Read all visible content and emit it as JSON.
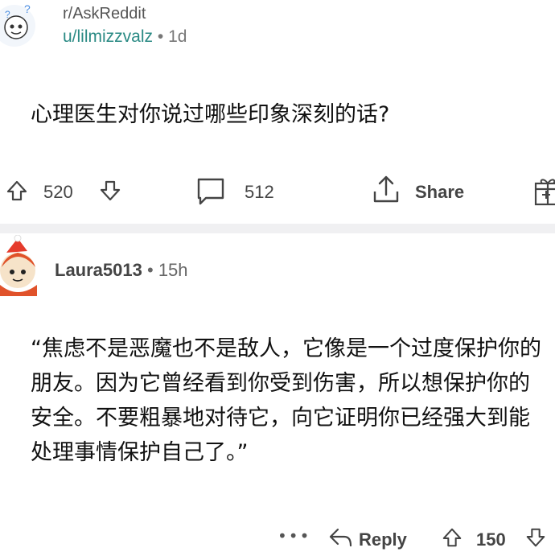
{
  "post": {
    "subreddit": "r/AskReddit",
    "username": "u/lilmizzvalz",
    "separator": "•",
    "age": "1d",
    "title": "心理医生对你说过哪些印象深刻的话?",
    "upvotes": "520",
    "comments": "512",
    "share_label": "Share"
  },
  "comment": {
    "username": "Laura5013",
    "separator": "•",
    "age": "15h",
    "text": "“焦虑不是恶魔也不是敌人，它像是一个过度保护你的朋友。因为它曾经看到你受到伤害，所以想保护你的安全。不要粗暴地对待它，向它证明你已经强大到能处理事情保护自己了。”",
    "more": "•••",
    "reply_label": "Reply",
    "votes": "150"
  },
  "colors": {
    "username_teal": "#2a8a84",
    "divider": "#f0f0f2",
    "icon_gray": "#444444"
  }
}
